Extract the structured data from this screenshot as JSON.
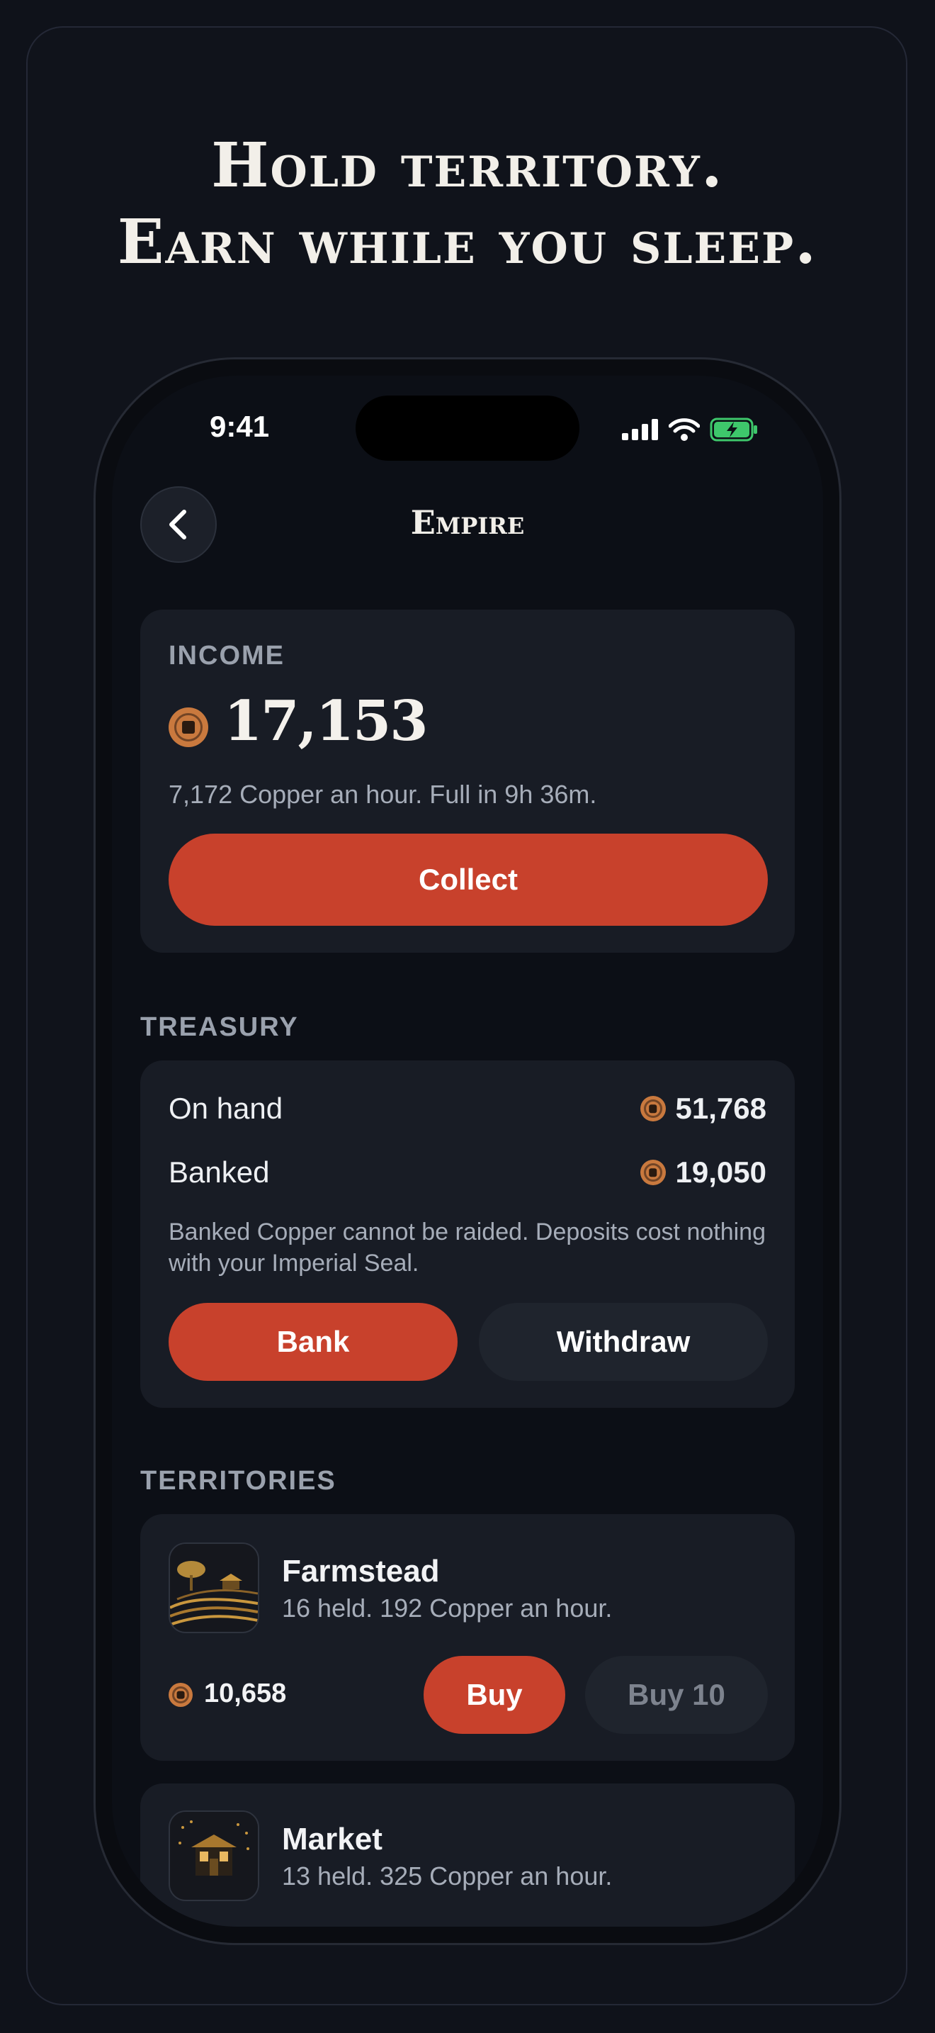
{
  "headline": {
    "line1": "Hold territory.",
    "line2": "Earn while you sleep."
  },
  "status_bar": {
    "time": "9:41"
  },
  "nav": {
    "title": "Empire"
  },
  "income": {
    "label": "INCOME",
    "amount": "17,153",
    "subtitle": "7,172 Copper an hour. Full in 9h 36m.",
    "collect_label": "Collect"
  },
  "treasury": {
    "label": "TREASURY",
    "on_hand_label": "On hand",
    "on_hand_value": "51,768",
    "banked_label": "Banked",
    "banked_value": "19,050",
    "note": "Banked Copper cannot be raided. Deposits cost nothing with your Imperial Seal.",
    "bank_label": "Bank",
    "withdraw_label": "Withdraw"
  },
  "territories": {
    "label": "TERRITORIES",
    "items": [
      {
        "name": "Farmstead",
        "subtitle": "16 held. 192 Copper an hour.",
        "price": "10,658",
        "buy_label": "Buy",
        "buy10_label": "Buy 10",
        "icon": "farm-terraces-icon"
      },
      {
        "name": "Market",
        "subtitle": "13 held. 325 Copper an hour.",
        "icon": "market-stall-icon"
      }
    ]
  },
  "colors": {
    "accent": "#c8412c",
    "coin": "#c9793e",
    "background": "#0f121a",
    "card": "#181c25"
  }
}
